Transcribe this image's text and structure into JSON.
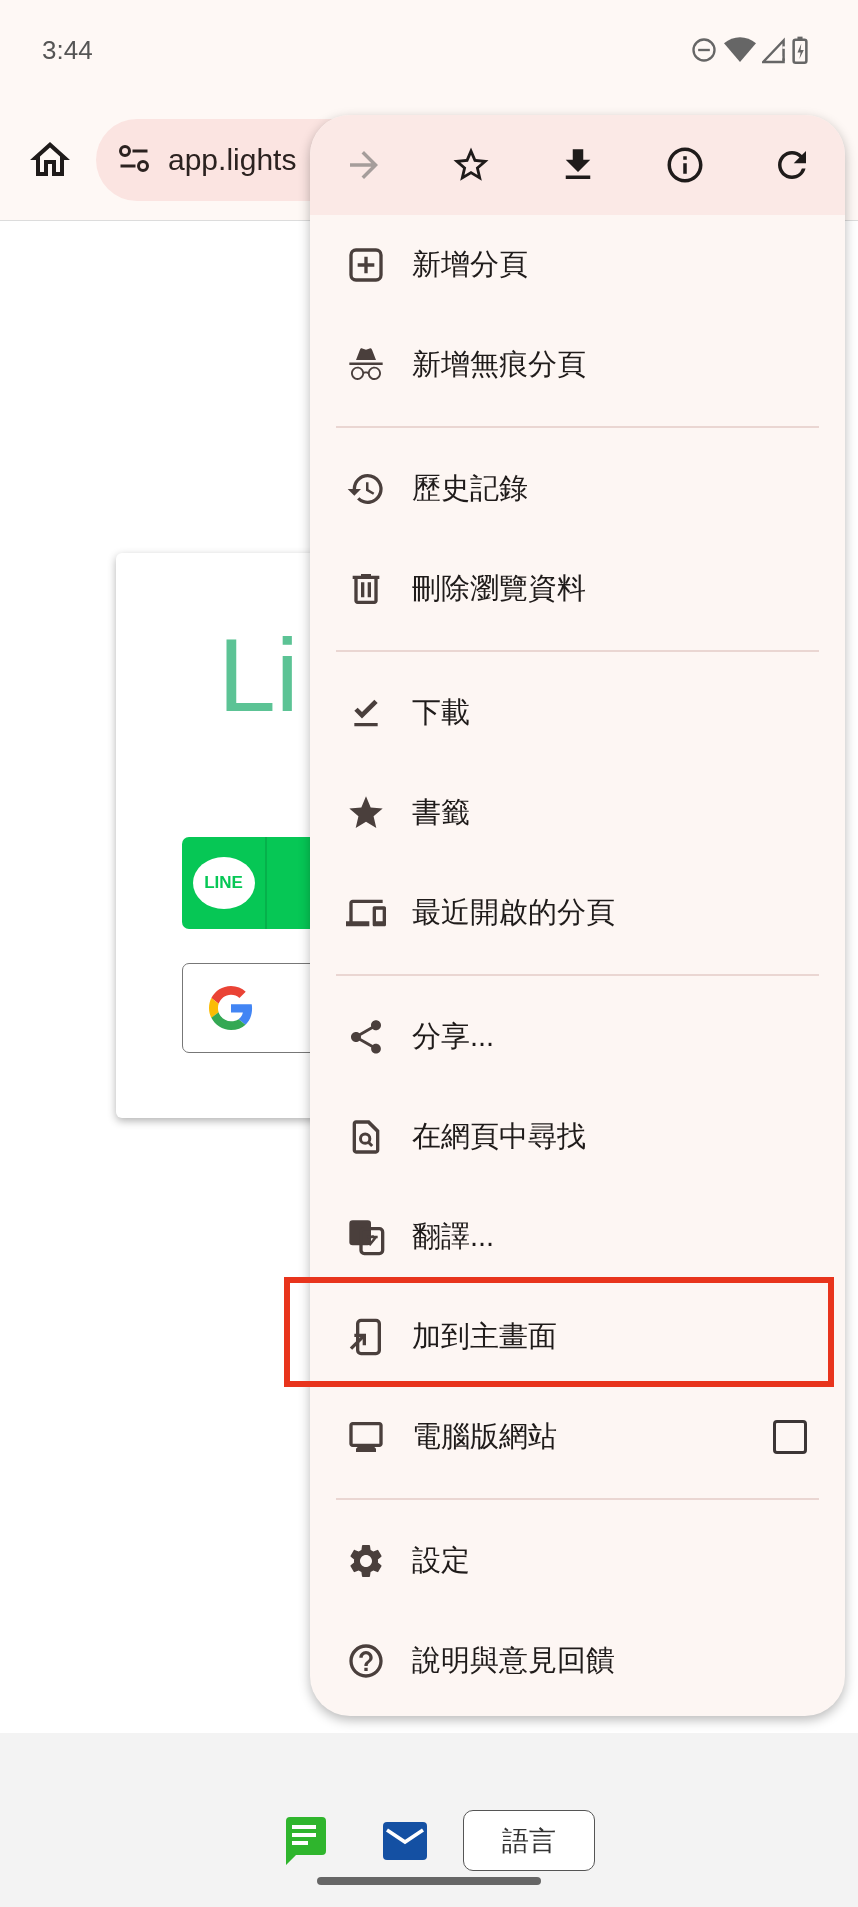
{
  "status_bar": {
    "time": "3:44"
  },
  "toolbar": {
    "url": "app.lights"
  },
  "login_card": {
    "title": "Li",
    "line_logo": "LINE"
  },
  "menu": {
    "toolbar": [
      {
        "kind": "forward",
        "disabled": true
      },
      {
        "kind": "bookmark",
        "disabled": false
      },
      {
        "kind": "download",
        "disabled": false
      },
      {
        "kind": "info",
        "disabled": false
      },
      {
        "kind": "reload",
        "disabled": false
      }
    ],
    "sections": [
      [
        {
          "kind": "action",
          "label": "新增分頁",
          "highlighted": false
        },
        {
          "kind": "action",
          "label": "新增無痕分頁",
          "highlighted": false
        }
      ],
      [
        {
          "kind": "action",
          "label": "歷史記錄",
          "highlighted": false
        },
        {
          "kind": "action",
          "label": "刪除瀏覽資料",
          "highlighted": false
        }
      ],
      [
        {
          "kind": "action",
          "label": "下載",
          "highlighted": false
        },
        {
          "kind": "action",
          "label": "書籤",
          "highlighted": false
        },
        {
          "kind": "action",
          "label": "最近開啟的分頁",
          "highlighted": false
        }
      ],
      [
        {
          "kind": "action",
          "label": "分享...",
          "highlighted": false
        },
        {
          "kind": "action",
          "label": "在網頁中尋找",
          "highlighted": false
        },
        {
          "kind": "action",
          "label": "翻譯...",
          "highlighted": false
        },
        {
          "kind": "action",
          "label": "加到主畫面",
          "highlighted": true
        },
        {
          "kind": "checkbox",
          "label": "電腦版網站",
          "checked": false,
          "highlighted": false
        }
      ],
      [
        {
          "kind": "action",
          "label": "設定",
          "highlighted": false
        },
        {
          "kind": "action",
          "label": "說明與意見回饋",
          "highlighted": false
        }
      ]
    ]
  },
  "bottom_bar": {
    "language_button": "語言"
  }
}
